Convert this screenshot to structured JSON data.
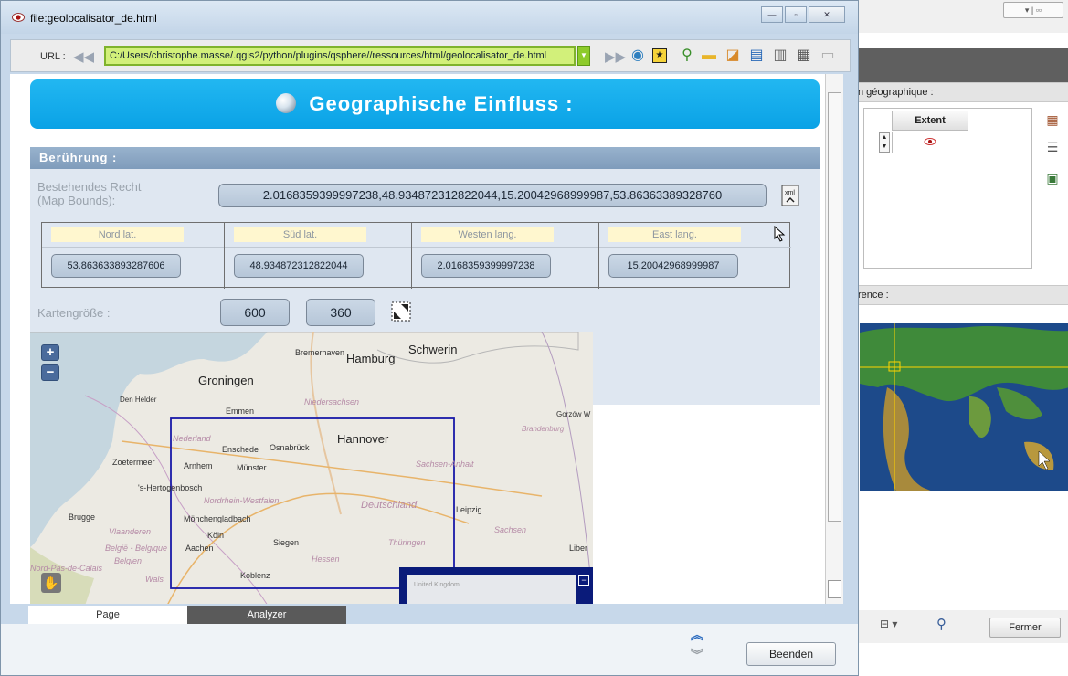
{
  "window": {
    "title": "file:geolocalisator_de.html",
    "controls": {
      "minimize": "—",
      "maximize": "▫",
      "close": "✕"
    }
  },
  "urlbar": {
    "label": "URL :",
    "value": "C:/Users/christophe.masse/.qgis2/python/plugins/qsphere//ressources/html/geolocalisator_de.html"
  },
  "page": {
    "banner_title": "Geographische Einfluss :",
    "section_title": "Berührung :",
    "bounds": {
      "label_line1": "Bestehendes Recht",
      "label_line2": "(Map Bounds):",
      "value": "2.0168359399997238,48.934872312822044,15.20042968999987,53.86363389328760"
    },
    "coords": [
      {
        "label": "Nord lat.",
        "value": "53.863633893287606"
      },
      {
        "label": "Süd lat.",
        "value": "48.934872312822044"
      },
      {
        "label": "Westen lang.",
        "value": "2.0168359399997238"
      },
      {
        "label": "East lang.",
        "value": "15.20042968999987"
      }
    ],
    "size": {
      "label": "Kartengröße :",
      "width": "600",
      "height": "360"
    }
  },
  "map": {
    "zoom_in": "+",
    "zoom_out": "−",
    "cities_big": [
      "Hamburg",
      "Schwerin",
      "Hannover",
      "Groningen"
    ],
    "cities": [
      "Bremerhaven",
      "Den Helder",
      "Emmen",
      "Gorzów W",
      "Enschede",
      "Osnabrück",
      "Zoetermeer",
      "Arnhem",
      "Münster",
      "'s-Hertogenbosch",
      "Brugge",
      "Mönchengladbach",
      "Leipzig",
      "Köln",
      "Aachen",
      "Siegen",
      "Liber",
      "Koblenz",
      "Wals"
    ],
    "regions": [
      "Niedersachsen",
      "Brandenburg",
      "Nederland",
      "Sachsen-Anhalt",
      "Nordrhein-Westfalen",
      "Deutschland",
      "Vlaanderen",
      "Sachsen",
      "België - Belgique",
      "Belgien",
      "Thüringen",
      "Hessen",
      "Nord-Pas-de-Calais"
    ],
    "overview_label": "United Kingdom"
  },
  "tabs": [
    {
      "label": "Page"
    },
    {
      "label": "Analyzer"
    }
  ],
  "footer": {
    "close_button": "Beenden"
  },
  "background_app": {
    "section1": "n géographique :",
    "table_header": "Extent",
    "section2": "rence :",
    "fermer": "Fermer"
  },
  "colors": {
    "banner": "#0aa2e6",
    "url_highlight": "#d2f07a",
    "panel_header": "#7f9cbb",
    "bbox": "#1a1aa8"
  }
}
